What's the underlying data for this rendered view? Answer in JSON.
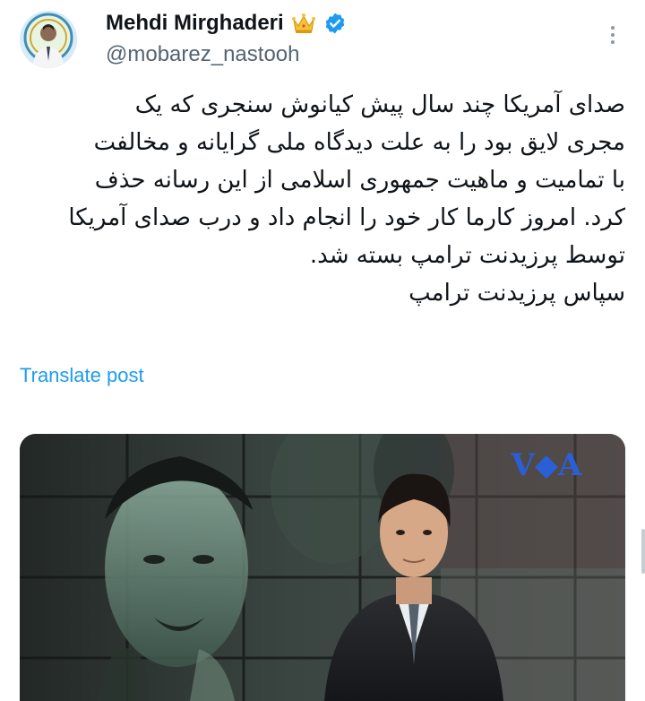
{
  "author": {
    "display_name": "Mehdi Mirghaderi",
    "handle": "@mobarez_nastooh"
  },
  "icons": {
    "badge": "crown-icon",
    "verified": "verified-icon",
    "more": "more-options-icon"
  },
  "post": {
    "lines": [
      "صدای آمریکا چند سال پیش کیانوش سنجری که یک",
      "مجری لایق بود را به علت دیدگاه  ملی گرایانه و مخالفت",
      "با تمامیت و ماهیت جمهوری اسلامی از این رسانه حذف",
      "کرد. امروز کارما کار خود را انجام داد و درب صدای آمریکا",
      "توسط پرزیدنت ترامپ بسته شد.",
      "سپاس پرزیدنت ترامپ"
    ],
    "translate_label": "Translate post"
  },
  "media": {
    "logo_text": "V◆A"
  },
  "colors": {
    "link": "#1d9bf0",
    "verified": "#1d9bf0",
    "text": "#0f1419",
    "muted": "#536471"
  }
}
